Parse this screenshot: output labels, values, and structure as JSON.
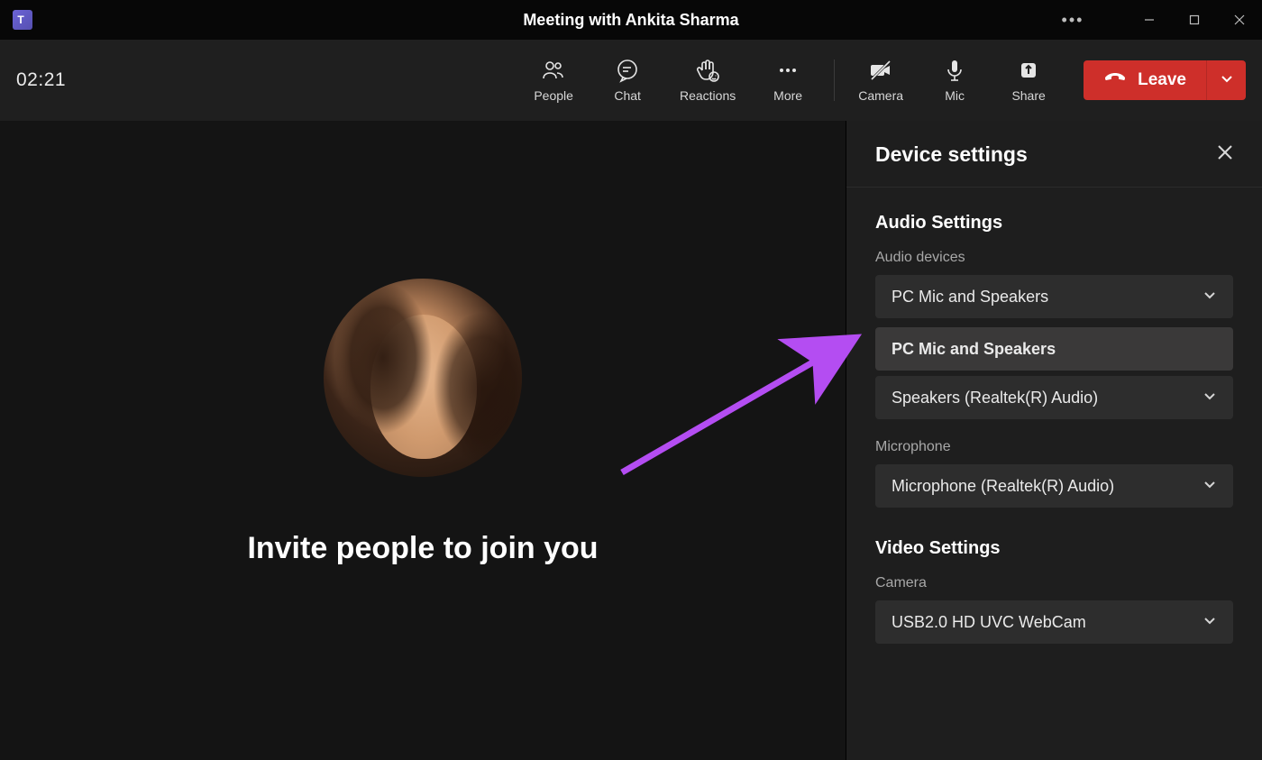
{
  "titlebar": {
    "title": "Meeting with Ankita Sharma"
  },
  "toolbar": {
    "timer": "02:21",
    "people": "People",
    "chat": "Chat",
    "reactions": "Reactions",
    "more": "More",
    "camera": "Camera",
    "mic": "Mic",
    "share": "Share",
    "leave": "Leave"
  },
  "stage": {
    "invite": "Invite people to join you"
  },
  "panel": {
    "title": "Device settings",
    "audio": {
      "heading": "Audio Settings",
      "devices_label": "Audio devices",
      "selected": "PC Mic and Speakers",
      "option_selected": "PC Mic and Speakers",
      "speaker_selected": "Speakers (Realtek(R) Audio)",
      "mic_label": "Microphone",
      "mic_selected": "Microphone (Realtek(R) Audio)"
    },
    "video": {
      "heading": "Video Settings",
      "camera_label": "Camera",
      "camera_selected": "USB2.0 HD UVC WebCam"
    }
  }
}
